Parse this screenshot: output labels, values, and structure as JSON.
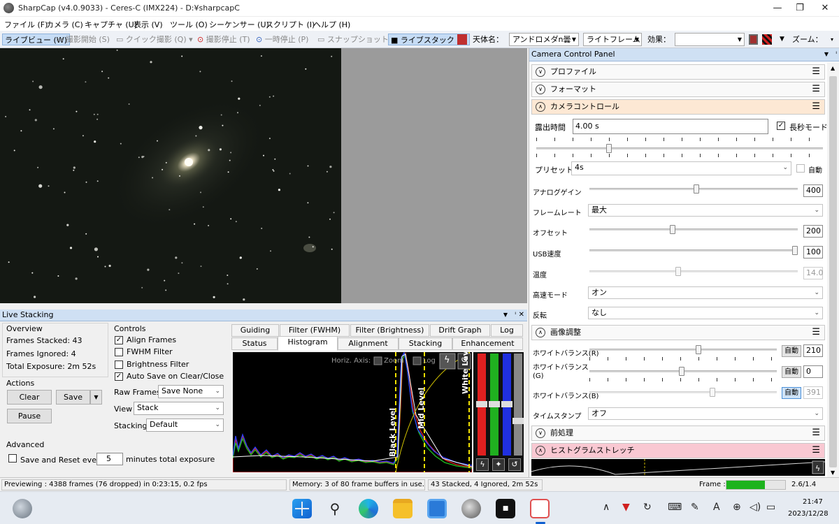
{
  "window": {
    "title": "SharpCap (v4.0.9033) - Ceres-C (IMX224) - D:¥sharpcapC",
    "minimize": "—",
    "maximize": "❐",
    "close": "✕"
  },
  "menu": [
    "ファイル (F)",
    "カメラ (C)",
    "キャプチャ (U)",
    "表示 (V)",
    "ツール (O)",
    "シーケンサー (U)",
    "スクリプト (I)",
    "ヘルプ (H)"
  ],
  "toolbar": {
    "live_view": "ライブビュー (W)",
    "start_capture": "撮影開始 (S)",
    "quick_capture": "クイック撮影 (Q)",
    "stop_capture": "撮影停止 (T)",
    "pause": "一時停止 (P)",
    "snapshot": "スナップショット (A)",
    "live_stack": "ライブスタック (L)",
    "target_label": "天体名：",
    "target_value": "アンドロメダn曇",
    "frame_type": "ライトフレーム",
    "effect_label": "効果：",
    "effect_value": "",
    "zoom_label": "ズーム："
  },
  "ccp": {
    "title": "Camera Control Panel",
    "sections": {
      "profile": "プロファイル",
      "format": "フォーマット",
      "camera_control": "カメラコントロール",
      "image_adjust": "画像調整",
      "preprocess": "前処理",
      "histogram_stretch": "ヒストグラムストレッチ"
    },
    "exposure_label": "露出時間",
    "exposure_value": "4.00 s",
    "long_exposure_label": "長秒モード",
    "long_exposure_checked": true,
    "preset_label": "プリセット",
    "preset_value": "4s",
    "auto_label": "自動",
    "analog_gain_label": "アナログゲイン",
    "analog_gain_value": "400",
    "frame_rate_label": "フレームレート",
    "frame_rate_value": "最大",
    "offset_label": "オフセット",
    "offset_value": "200",
    "usb_label": "USB速度",
    "usb_value": "100",
    "temp_label": "温度",
    "temp_value": "14.0",
    "highspeed_label": "高速モード",
    "highspeed_value": "オン",
    "flip_label": "反転",
    "flip_value": "なし",
    "wb_r_label": "ホワイトバランス(R)",
    "wb_r_value": "210",
    "wb_g_label": "ホワイトバランス(G)",
    "wb_g_value": "0",
    "wb_b_label": "ホワイトバランス(B)",
    "wb_b_value": "391",
    "timestamp_label": "タイムスタンプ",
    "timestamp_value": "オフ"
  },
  "live_stacking": {
    "title": "Live Stacking",
    "overview_label": "Overview",
    "frames_stacked": "Frames Stacked: 43",
    "frames_ignored": "Frames Ignored: 4",
    "total_exposure": "Total Exposure:  2m 52s",
    "actions_label": "Actions",
    "clear": "Clear",
    "save": "Save",
    "pause": "Pause",
    "advanced_label": "Advanced",
    "save_reset_label": "Save and Reset every",
    "save_reset_minutes": "5",
    "save_reset_suffix": "minutes total exposure",
    "controls_label": "Controls",
    "align_frames": "Align Frames",
    "fwhm_filter": "FWHM Filter",
    "brightness_filter": "Brightness Filter",
    "auto_save": "Auto Save on Clear/Close",
    "raw_frames_label": "Raw Frames",
    "raw_frames_value": "Save None",
    "view_label": "View",
    "view_value": "Stack",
    "stacking_label": "Stacking",
    "stacking_value": "Default",
    "tabs_top": [
      "Guiding",
      "Filter (FWHM)",
      "Filter (Brightness)",
      "Drift Graph",
      "Log"
    ],
    "tabs_bottom": [
      "Status",
      "Histogram",
      "Alignment",
      "Stacking",
      "Enhancement"
    ],
    "histogram": {
      "horiz_axis": "Horiz. Axis:",
      "zoom": "Zoom",
      "log": "Log",
      "black_level": "Black Level",
      "mid_level": "Mid Level",
      "white_level": "White Level"
    }
  },
  "statusbar": {
    "previewing": "Previewing : 4388 frames (76 dropped) in 0:23:15, 0.2 fps",
    "memory": "Memory: 3 of 80 frame buffers in use.",
    "stacked": "43 Stacked, 4 Ignored, 2m 52s",
    "frame_label": "Frame :",
    "frame_progress": 0.65,
    "frame_value": "2.6/1.4"
  },
  "taskbar": {
    "time": "21:47",
    "date": "2023/12/28",
    "ime": "A"
  },
  "colors": {
    "accent": "#c6dcf5",
    "camera_section": "#fde8d4",
    "histogram_section": "#f9c8d2",
    "progress_green": "#1db31d"
  }
}
